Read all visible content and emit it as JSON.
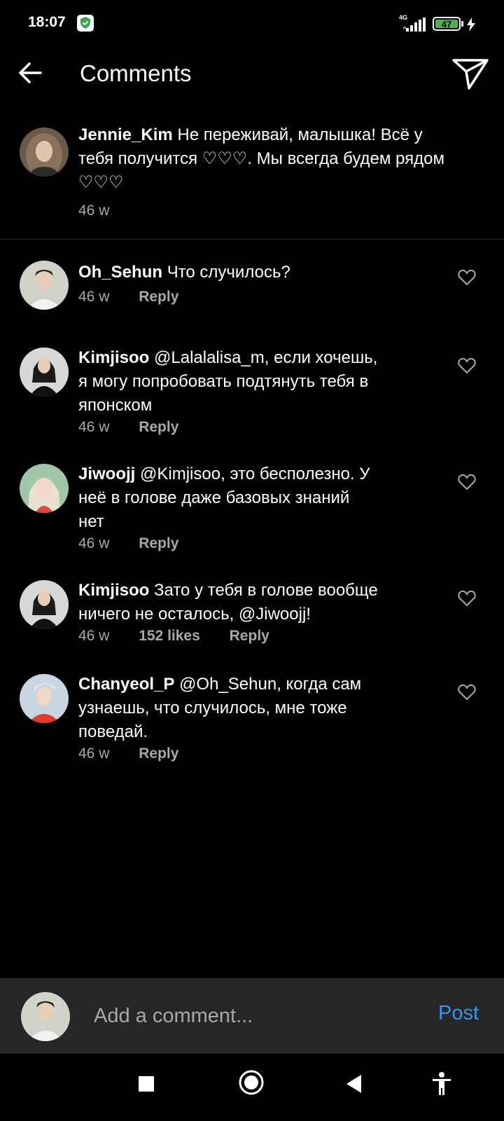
{
  "status_bar": {
    "time": "18:07",
    "network": "4G",
    "battery": "47",
    "icons": [
      "shield-check-icon",
      "signal-icon",
      "battery-icon",
      "charging-icon"
    ]
  },
  "header": {
    "title": "Comments",
    "back_icon": "arrow-left-icon",
    "share_icon": "send-icon"
  },
  "caption": {
    "username": "Jennie_Kim",
    "text": "Не переживай, малышка! Всё у тебя получится ♡♡♡. Мы всегда будем рядом ♡♡♡",
    "lines": [
      "Не переживай, малышка! Всё у",
      "тебя получится ♡♡♡. Мы всегда будем рядом",
      "♡♡♡"
    ],
    "time": "46 w"
  },
  "comments": [
    {
      "username": "Oh_Sehun",
      "lines": [
        "Что случилось?"
      ],
      "time": "46 w",
      "likes": "",
      "reply": "Reply"
    },
    {
      "username": "Kimjisoo",
      "lines": [
        "@Lalalalisa_m, если хочешь,",
        "я могу попробовать подтянуть тебя в",
        "японском"
      ],
      "time": "46 w",
      "likes": "",
      "reply": "Reply"
    },
    {
      "username": "Jiwoojj",
      "lines": [
        "@Kimjisoo, это бесполезно. У",
        "неё в голове даже базовых знаний",
        "нет"
      ],
      "time": "46 w",
      "likes": "",
      "reply": "Reply"
    },
    {
      "username": "Kimjisoo",
      "lines": [
        "Зато у тебя в голове вообще",
        "ничего не осталось, @Jiwoojj!"
      ],
      "time": "46 w",
      "likes": "152 likes",
      "reply": "Reply"
    },
    {
      "username": "Chanyeol_P",
      "lines": [
        "@Oh_Sehun, когда сам",
        "узнаешь, что случилось, мне тоже",
        "поведай."
      ],
      "time": "46 w",
      "likes": "",
      "reply": "Reply"
    }
  ],
  "input": {
    "placeholder": "Add a comment...",
    "post_label": "Post"
  },
  "nav_bar": {
    "icons": [
      "recents-square-icon",
      "home-circle-icon",
      "back-triangle-icon",
      "accessibility-icon"
    ]
  },
  "colors": {
    "background": "#000000",
    "secondary_text": "#a8a8a8",
    "post_blue": "#3797f0",
    "input_bar": "#262626",
    "battery_green": "#4caf50"
  }
}
